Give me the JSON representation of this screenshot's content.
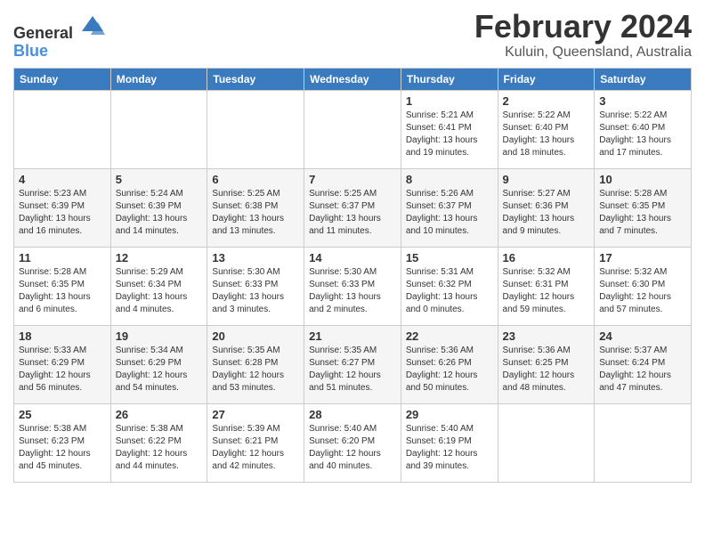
{
  "logo": {
    "general": "General",
    "blue": "Blue"
  },
  "title": "February 2024",
  "location": "Kuluin, Queensland, Australia",
  "days_of_week": [
    "Sunday",
    "Monday",
    "Tuesday",
    "Wednesday",
    "Thursday",
    "Friday",
    "Saturday"
  ],
  "weeks": [
    [
      {
        "day": "",
        "info": ""
      },
      {
        "day": "",
        "info": ""
      },
      {
        "day": "",
        "info": ""
      },
      {
        "day": "",
        "info": ""
      },
      {
        "day": "1",
        "info": "Sunrise: 5:21 AM\nSunset: 6:41 PM\nDaylight: 13 hours\nand 19 minutes."
      },
      {
        "day": "2",
        "info": "Sunrise: 5:22 AM\nSunset: 6:40 PM\nDaylight: 13 hours\nand 18 minutes."
      },
      {
        "day": "3",
        "info": "Sunrise: 5:22 AM\nSunset: 6:40 PM\nDaylight: 13 hours\nand 17 minutes."
      }
    ],
    [
      {
        "day": "4",
        "info": "Sunrise: 5:23 AM\nSunset: 6:39 PM\nDaylight: 13 hours\nand 16 minutes."
      },
      {
        "day": "5",
        "info": "Sunrise: 5:24 AM\nSunset: 6:39 PM\nDaylight: 13 hours\nand 14 minutes."
      },
      {
        "day": "6",
        "info": "Sunrise: 5:25 AM\nSunset: 6:38 PM\nDaylight: 13 hours\nand 13 minutes."
      },
      {
        "day": "7",
        "info": "Sunrise: 5:25 AM\nSunset: 6:37 PM\nDaylight: 13 hours\nand 11 minutes."
      },
      {
        "day": "8",
        "info": "Sunrise: 5:26 AM\nSunset: 6:37 PM\nDaylight: 13 hours\nand 10 minutes."
      },
      {
        "day": "9",
        "info": "Sunrise: 5:27 AM\nSunset: 6:36 PM\nDaylight: 13 hours\nand 9 minutes."
      },
      {
        "day": "10",
        "info": "Sunrise: 5:28 AM\nSunset: 6:35 PM\nDaylight: 13 hours\nand 7 minutes."
      }
    ],
    [
      {
        "day": "11",
        "info": "Sunrise: 5:28 AM\nSunset: 6:35 PM\nDaylight: 13 hours\nand 6 minutes."
      },
      {
        "day": "12",
        "info": "Sunrise: 5:29 AM\nSunset: 6:34 PM\nDaylight: 13 hours\nand 4 minutes."
      },
      {
        "day": "13",
        "info": "Sunrise: 5:30 AM\nSunset: 6:33 PM\nDaylight: 13 hours\nand 3 minutes."
      },
      {
        "day": "14",
        "info": "Sunrise: 5:30 AM\nSunset: 6:33 PM\nDaylight: 13 hours\nand 2 minutes."
      },
      {
        "day": "15",
        "info": "Sunrise: 5:31 AM\nSunset: 6:32 PM\nDaylight: 13 hours\nand 0 minutes."
      },
      {
        "day": "16",
        "info": "Sunrise: 5:32 AM\nSunset: 6:31 PM\nDaylight: 12 hours\nand 59 minutes."
      },
      {
        "day": "17",
        "info": "Sunrise: 5:32 AM\nSunset: 6:30 PM\nDaylight: 12 hours\nand 57 minutes."
      }
    ],
    [
      {
        "day": "18",
        "info": "Sunrise: 5:33 AM\nSunset: 6:29 PM\nDaylight: 12 hours\nand 56 minutes."
      },
      {
        "day": "19",
        "info": "Sunrise: 5:34 AM\nSunset: 6:29 PM\nDaylight: 12 hours\nand 54 minutes."
      },
      {
        "day": "20",
        "info": "Sunrise: 5:35 AM\nSunset: 6:28 PM\nDaylight: 12 hours\nand 53 minutes."
      },
      {
        "day": "21",
        "info": "Sunrise: 5:35 AM\nSunset: 6:27 PM\nDaylight: 12 hours\nand 51 minutes."
      },
      {
        "day": "22",
        "info": "Sunrise: 5:36 AM\nSunset: 6:26 PM\nDaylight: 12 hours\nand 50 minutes."
      },
      {
        "day": "23",
        "info": "Sunrise: 5:36 AM\nSunset: 6:25 PM\nDaylight: 12 hours\nand 48 minutes."
      },
      {
        "day": "24",
        "info": "Sunrise: 5:37 AM\nSunset: 6:24 PM\nDaylight: 12 hours\nand 47 minutes."
      }
    ],
    [
      {
        "day": "25",
        "info": "Sunrise: 5:38 AM\nSunset: 6:23 PM\nDaylight: 12 hours\nand 45 minutes."
      },
      {
        "day": "26",
        "info": "Sunrise: 5:38 AM\nSunset: 6:22 PM\nDaylight: 12 hours\nand 44 minutes."
      },
      {
        "day": "27",
        "info": "Sunrise: 5:39 AM\nSunset: 6:21 PM\nDaylight: 12 hours\nand 42 minutes."
      },
      {
        "day": "28",
        "info": "Sunrise: 5:40 AM\nSunset: 6:20 PM\nDaylight: 12 hours\nand 40 minutes."
      },
      {
        "day": "29",
        "info": "Sunrise: 5:40 AM\nSunset: 6:19 PM\nDaylight: 12 hours\nand 39 minutes."
      },
      {
        "day": "",
        "info": ""
      },
      {
        "day": "",
        "info": ""
      }
    ]
  ]
}
